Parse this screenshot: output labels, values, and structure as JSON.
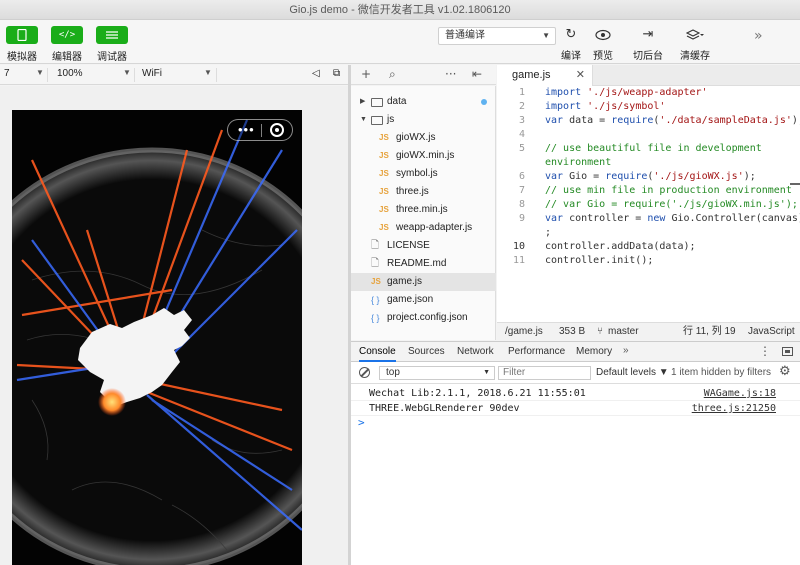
{
  "window": {
    "title": "Gio.js demo - 微信开发者工具 v1.02.1806120"
  },
  "toolbar": {
    "simulator": {
      "label": "模拟器",
      "icon": "phone-icon"
    },
    "editor": {
      "label": "编辑器",
      "icon": "code-icon",
      "glyph": "</>"
    },
    "debugger": {
      "label": "调试器",
      "icon": "debug-icon"
    },
    "compile_mode": "普通编译",
    "compile": {
      "label": "编译",
      "icon": "refresh-icon"
    },
    "preview": {
      "label": "预览",
      "icon": "eye-icon"
    },
    "background": {
      "label": "切后台",
      "icon": "switch-background-icon"
    },
    "clear_cache": {
      "label": "清缓存",
      "icon": "layers-icon"
    }
  },
  "simulator_bar": {
    "device": "7",
    "zoom": "100%",
    "network": "WiFi"
  },
  "explorer": {
    "items": [
      {
        "name": "data",
        "type": "folder",
        "expanded": false
      },
      {
        "name": "js",
        "type": "folder",
        "expanded": true
      },
      {
        "name": "gioWX.js",
        "type": "js"
      },
      {
        "name": "gioWX.min.js",
        "type": "js"
      },
      {
        "name": "symbol.js",
        "type": "js"
      },
      {
        "name": "three.js",
        "type": "js"
      },
      {
        "name": "three.min.js",
        "type": "js"
      },
      {
        "name": "weapp-adapter.js",
        "type": "js"
      },
      {
        "name": "LICENSE",
        "type": "doc"
      },
      {
        "name": "README.md",
        "type": "doc"
      },
      {
        "name": "game.js",
        "type": "js"
      },
      {
        "name": "game.json",
        "type": "json"
      },
      {
        "name": "project.config.json",
        "type": "json"
      }
    ]
  },
  "editor": {
    "tab_label": "game.js",
    "lines": [
      {
        "n": "1",
        "text": "import './js/weapp-adapter'"
      },
      {
        "n": "2",
        "text": "import './js/symbol'"
      },
      {
        "n": "3",
        "text": "var data = require('./data/sampleData.js');"
      },
      {
        "n": "4",
        "text": ""
      },
      {
        "n": "5",
        "text": "// use beautiful file in development"
      },
      {
        "n": "",
        "text": "environment"
      },
      {
        "n": "6",
        "text": "var Gio = require('./js/gioWX.js');"
      },
      {
        "n": "7",
        "text": "// use min file in production environment"
      },
      {
        "n": "8",
        "text": "// var Gio = require('./js/gioWX.min.js');"
      },
      {
        "n": "9",
        "text": "var controller = new Gio.Controller(canvas)"
      },
      {
        "n": "",
        "text": ";"
      },
      {
        "n": "10",
        "text": "controller.addData(data);"
      },
      {
        "n": "11",
        "text": "controller.init();"
      }
    ]
  },
  "status": {
    "path": "/game.js",
    "size": "353 B",
    "branch": "master",
    "position": "行 11, 列 19",
    "language": "JavaScript"
  },
  "devtools": {
    "tabs": [
      "Console",
      "Sources",
      "Network",
      "Performance",
      "Memory"
    ],
    "more": "»",
    "context": "top",
    "filter_placeholder": "Filter",
    "levels": "Default levels ▼",
    "hidden_note": "1 item hidden by filters",
    "logs": [
      {
        "message": "Wechat Lib:2.1.1, 2018.6.21 11:55:01",
        "source": "WAGame.js:18"
      },
      {
        "message": "THREE.WebGLRenderer 90dev",
        "source": "three.js:21250"
      }
    ],
    "prompt": ">"
  },
  "colors": {
    "accent": "#1aad19",
    "globe_land": "#ffffff",
    "highlight_out": "#ff5a1f",
    "highlight_in": "#3a6cff"
  }
}
